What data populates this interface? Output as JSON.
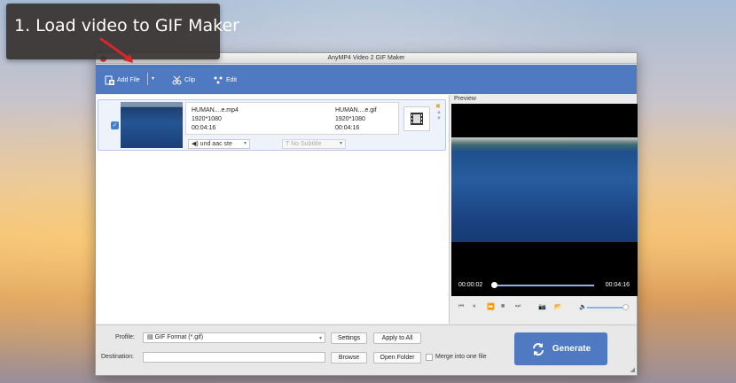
{
  "caption": {
    "text": "1. Load video to GIF Maker"
  },
  "window": {
    "title": "AnyMP4 Video 2 GIF Maker"
  },
  "toolbar": {
    "add_file_label": "Add File",
    "clip_label": "Clip",
    "edit_label": "Edit"
  },
  "file": {
    "checked": true,
    "source_name": "HUMAN....e.mp4",
    "source_resolution": "1920*1080",
    "source_duration": "00:04:16",
    "output_name": "HUMAN....e.gif",
    "output_resolution": "1920*1080",
    "output_duration": "00:04:16",
    "audio_track": "und aac ste",
    "subtitle": "No Subtitle"
  },
  "preview": {
    "label": "Preview",
    "current_time": "00:00:02",
    "total_time": "00:04:16",
    "progress": 0.01,
    "volume": 0.95
  },
  "bottom": {
    "profile_label": "Profile:",
    "profile_value": "GIF Format (*.gif)",
    "settings_label": "Settings",
    "apply_all_label": "Apply to All",
    "destination_label": "Destination:",
    "destination_value": "",
    "browse_label": "Browse",
    "open_folder_label": "Open Folder",
    "merge_label": "Merge into one file",
    "generate_label": "Generate"
  },
  "colors": {
    "accent": "#4f79c0",
    "close_red": "#e0443e",
    "caption_arrow": "#d8262c"
  }
}
